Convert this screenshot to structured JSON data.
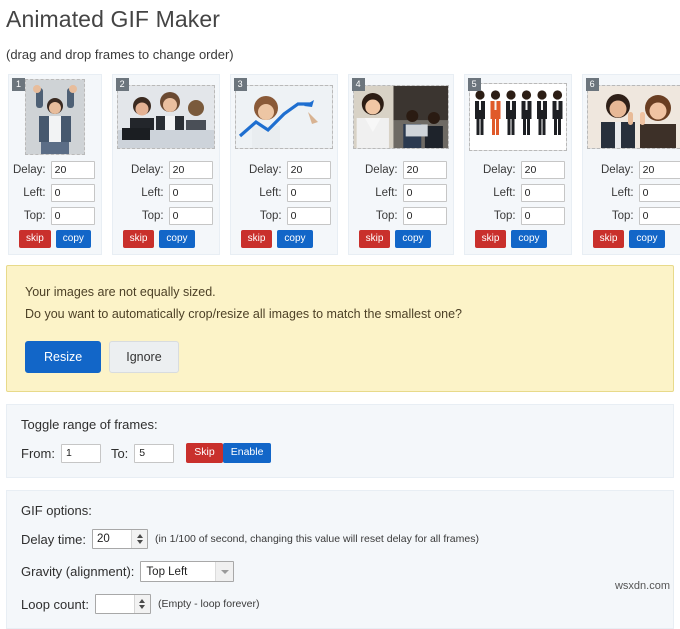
{
  "header": {
    "title": "Animated GIF Maker",
    "subtitle": "(drag and drop frames to change order)"
  },
  "frames": {
    "labels": {
      "delay": "Delay:",
      "left": "Left:",
      "top": "Top:",
      "skip": "skip",
      "copy": "copy"
    },
    "items": [
      {
        "number": "1",
        "delay": "20",
        "left": "0",
        "top": "0",
        "thumb_alt": "man-cheering-arms-up",
        "thumb_w": 58,
        "thumb_h": 74
      },
      {
        "number": "2",
        "delay": "20",
        "left": "0",
        "top": "0",
        "thumb_alt": "business-team-celebrating",
        "thumb_w": 98,
        "thumb_h": 62
      },
      {
        "number": "3",
        "delay": "20",
        "left": "0",
        "top": "0",
        "thumb_alt": "woman-drawing-growth-arrow",
        "thumb_w": 98,
        "thumb_h": 62
      },
      {
        "number": "4",
        "delay": "20",
        "left": "0",
        "top": "0",
        "thumb_alt": "businesswoman-with-team",
        "thumb_w": 94,
        "thumb_h": 62
      },
      {
        "number": "5",
        "delay": "20",
        "left": "0",
        "top": "0",
        "thumb_alt": "row-of-suited-figures",
        "thumb_w": 98,
        "thumb_h": 66
      },
      {
        "number": "6",
        "delay": "20",
        "left": "0",
        "top": "0",
        "thumb_alt": "couple-framing-hands",
        "thumb_w": 98,
        "thumb_h": 62
      }
    ]
  },
  "warning": {
    "line1": "Your images are not equally sized.",
    "line2": "Do you want to automatically crop/resize all images to match the smallest one?",
    "resize_label": "Resize",
    "ignore_label": "Ignore"
  },
  "toggle_range": {
    "title": "Toggle range of frames:",
    "from_label": "From:",
    "from_value": "1",
    "to_label": "To:",
    "to_value": "5",
    "skip_label": "Skip",
    "enable_label": "Enable"
  },
  "gif_options": {
    "title": "GIF options:",
    "delay_label": "Delay time:",
    "delay_value": "20",
    "delay_hint": "(in 1/100 of second, changing this value will reset delay for all frames)",
    "gravity_label": "Gravity (alignment):",
    "gravity_value": "Top Left",
    "loop_label": "Loop count:",
    "loop_value": "",
    "loop_hint": "(Empty - loop forever)"
  },
  "watermark": "wsxdn.com",
  "colors": {
    "primary_blue": "#1266c8",
    "danger_red": "#c9302c",
    "warning_bg": "#fcf3c8",
    "warning_border": "#e8da8a",
    "panel_bg": "#f4f7fa",
    "badge_gray": "#6c757d"
  }
}
